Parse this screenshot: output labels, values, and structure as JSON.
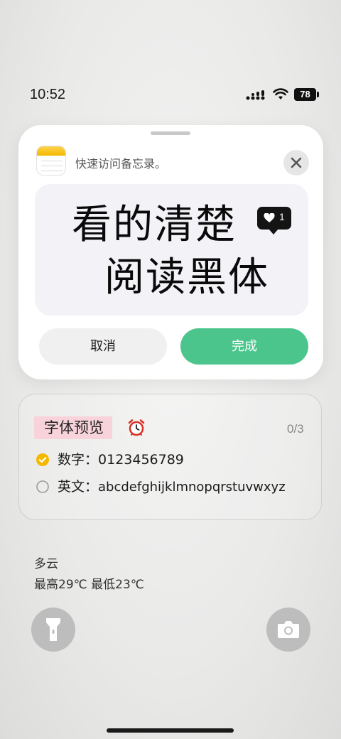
{
  "status_bar": {
    "time": "10:52",
    "battery": "78",
    "icons": [
      "signal-icon",
      "wifi-icon",
      "battery-icon"
    ]
  },
  "sheet": {
    "app_icon": "notes-app-icon",
    "header_title": "快速访问备忘录。",
    "close_icon": "close-icon",
    "preview": {
      "line1": "看的清楚",
      "line2": "阅读黑体",
      "badge_icon": "heart-icon",
      "badge_count": "1"
    },
    "cancel_label": "取消",
    "done_label": "完成"
  },
  "widget": {
    "title": "字体预览",
    "title_icon": "alarm-clock-icon",
    "progress": "0/3",
    "rows": [
      {
        "checked": true,
        "label": "数字：",
        "value": "0123456789"
      },
      {
        "checked": false,
        "label": "英文：",
        "value": "abcdefghijklmnopqrstuvwxyz"
      }
    ]
  },
  "weather": {
    "condition": "多云",
    "temperature": "最高29℃  最低23℃"
  },
  "quick_actions": {
    "left_icon": "flashlight-icon",
    "right_icon": "camera-icon"
  },
  "colors": {
    "accent_green": "#4cc58d",
    "check_yellow": "#f5b800",
    "title_highlight": "#f9d3dc"
  }
}
